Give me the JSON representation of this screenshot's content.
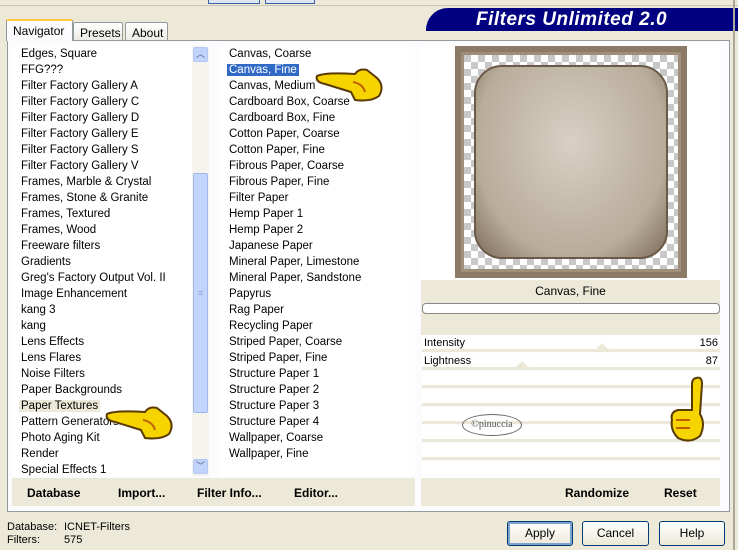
{
  "tabs": [
    {
      "label": "Navigator",
      "active": true
    },
    {
      "label": "Presets"
    },
    {
      "label": "About"
    }
  ],
  "banner": "Filters Unlimited 2.0",
  "categories": [
    "Edges, Square",
    "FFG???",
    "Filter Factory Gallery A",
    "Filter Factory Gallery C",
    "Filter Factory Gallery D",
    "Filter Factory Gallery E",
    "Filter Factory Gallery S",
    "Filter Factory Gallery V",
    "Frames, Marble & Crystal",
    "Frames, Stone & Granite",
    "Frames, Textured",
    "Frames, Wood",
    "Freeware filters",
    "Gradients",
    "Greg's Factory Output Vol. II",
    "Image Enhancement",
    "kang 3",
    "kang",
    "Lens Effects",
    "Lens Flares",
    "Noise Filters",
    "Paper Backgrounds",
    "Paper Textures",
    "Pattern Generators",
    "Photo Aging Kit",
    "Render",
    "Special Effects 1"
  ],
  "selected_category": "Paper Textures",
  "filters": [
    "Canvas, Coarse",
    "Canvas, Fine",
    "Canvas, Medium",
    "Cardboard Box, Coarse",
    "Cardboard Box, Fine",
    "Cotton Paper, Coarse",
    "Cotton Paper, Fine",
    "Fibrous Paper, Coarse",
    "Fibrous Paper, Fine",
    "Filter Paper",
    "Hemp Paper 1",
    "Hemp Paper 2",
    "Japanese Paper",
    "Mineral Paper, Limestone",
    "Mineral Paper, Sandstone",
    "Papyrus",
    "Rag Paper",
    "Recycling Paper",
    "Striped Paper, Coarse",
    "Striped Paper, Fine",
    "Structure Paper 1",
    "Structure Paper 2",
    "Structure Paper 3",
    "Structure Paper 4",
    "Wallpaper, Coarse",
    "Wallpaper, Fine"
  ],
  "selected_filter": "Canvas, Fine",
  "preview_label": "Canvas, Fine",
  "params": [
    {
      "label": "Intensity",
      "value": "156",
      "max": 255
    },
    {
      "label": "Lightness",
      "value": "87",
      "max": 255
    }
  ],
  "watermark": "©pinuccia",
  "bottom_buttons": {
    "database": "Database",
    "import": "Import...",
    "filter_info": "Filter Info...",
    "editor": "Editor...",
    "randomize": "Randomize",
    "reset": "Reset"
  },
  "status": {
    "database_label": "Database:",
    "database_value": "ICNET-Filters",
    "filters_label": "Filters:",
    "filters_value": "575"
  },
  "dialog_buttons": {
    "apply": "Apply",
    "cancel": "Cancel",
    "help": "Help"
  },
  "colors": {
    "banner": "#000080",
    "selection": "#316ac5",
    "scrollbar": "#c3d5fd"
  }
}
